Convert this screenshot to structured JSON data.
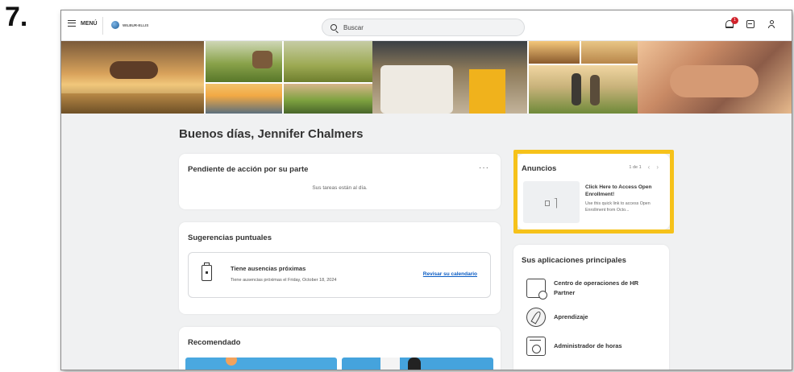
{
  "step_number": "7.",
  "topbar": {
    "menu_label": "MENÚ",
    "logo_text": "WILBUR-ELLIS",
    "search_placeholder": "Buscar",
    "notification_count": "1"
  },
  "main": {
    "greeting": "Buenos días, Jennifer Chalmers",
    "pending": {
      "title": "Pendiente de acción por su parte",
      "more": "···",
      "message": "Sus tareas están al día."
    },
    "suggestions": {
      "title": "Sugerencias puntuales",
      "item_title": "Tiene ausencias próximas",
      "item_detail": "Tiene ausencias próximas el Friday, October 18, 2024",
      "item_link": "Revisar su calendario"
    },
    "recommended": {
      "title": "Recomendado"
    }
  },
  "announcements": {
    "title": "Anuncios",
    "pager": "1 de 1",
    "prev": "‹",
    "next": "›",
    "item_title": "Click Here to Access Open Enrollment!",
    "item_desc": "Use this quick link to access Open Enrollment from Octo..."
  },
  "apps": {
    "title": "Sus aplicaciones principales",
    "items": [
      {
        "label": "Centro de operaciones de HR Partner"
      },
      {
        "label": "Aprendizaje"
      },
      {
        "label": "Administrador de horas"
      }
    ]
  },
  "colors": {
    "highlight": "#f6c21a",
    "link": "#0b5dc4",
    "badge": "#d1222b"
  }
}
